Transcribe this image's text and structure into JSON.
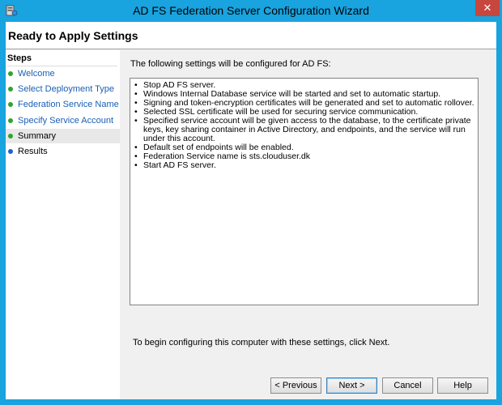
{
  "window": {
    "title": "AD FS Federation Server Configuration Wizard",
    "close_symbol": "✕",
    "icon": "server-app-icon"
  },
  "header": {
    "title": "Ready to Apply Settings"
  },
  "steps": {
    "title": "Steps",
    "items": [
      {
        "label": "Welcome",
        "state": "done"
      },
      {
        "label": "Select Deployment Type",
        "state": "done"
      },
      {
        "label": "Federation Service Name",
        "state": "done"
      },
      {
        "label": "Specify Service Account",
        "state": "done"
      },
      {
        "label": "Summary",
        "state": "active"
      },
      {
        "label": "Results",
        "state": "pending"
      }
    ]
  },
  "main": {
    "intro": "The following settings will be configured for AD FS:",
    "settings": [
      "Stop AD FS server.",
      "Windows Internal Database service will be started and set to automatic startup.",
      "Signing and token-encryption certificates will be generated and set to automatic rollover.",
      "Selected SSL certificate will be used for securing service communication.",
      "Specified service account will be given access to the database, to the certificate private keys, key sharing container in Active Directory, and endpoints, and the service will run under this account.",
      "Default set of endpoints will be enabled.",
      "Federation Service name is sts.clouduser.dk",
      "Start AD FS server."
    ],
    "footer_note": "To begin configuring this computer with these settings, click Next."
  },
  "buttons": {
    "previous": "< Previous",
    "next": "Next >",
    "cancel": "Cancel",
    "help": "Help"
  },
  "colors": {
    "titlebar": "#19a3df",
    "close": "#c7463d",
    "link": "#1a5fb4",
    "step_done": "#2ea52e",
    "step_pending": "#2060d8"
  }
}
